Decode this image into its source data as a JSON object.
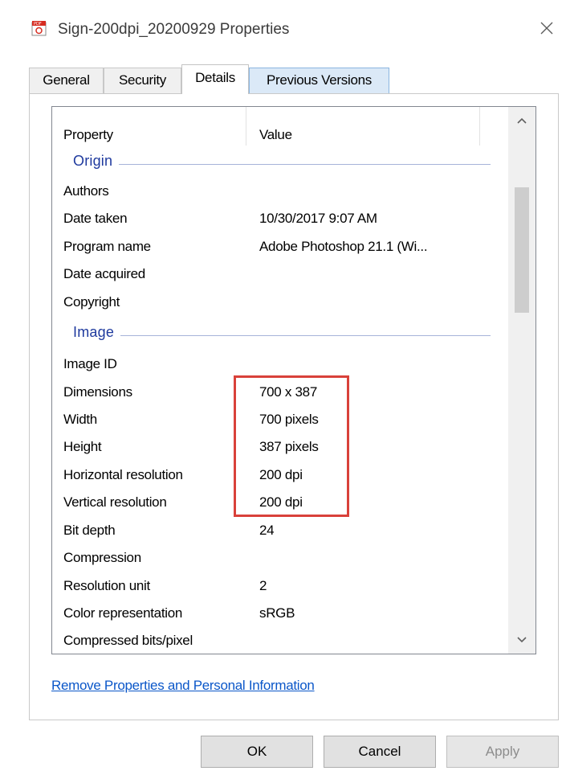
{
  "window": {
    "title": "Sign-200dpi_20200929 Properties",
    "title_icon": "pdf-file-icon",
    "close_icon": "close-icon"
  },
  "tabs": [
    {
      "label": "General"
    },
    {
      "label": "Security"
    },
    {
      "label": "Details",
      "active": true
    },
    {
      "label": "Previous Versions"
    }
  ],
  "details": {
    "header": {
      "property": "Property",
      "value": "Value"
    },
    "groups": [
      {
        "name": "Origin",
        "rows": [
          {
            "property": "Authors",
            "value": ""
          },
          {
            "property": "Date taken",
            "value": "10/30/2017 9:07 AM"
          },
          {
            "property": "Program name",
            "value": "Adobe Photoshop 21.1 (Wi..."
          },
          {
            "property": "Date acquired",
            "value": ""
          },
          {
            "property": "Copyright",
            "value": ""
          }
        ]
      },
      {
        "name": "Image",
        "rows": [
          {
            "property": "Image ID",
            "value": ""
          },
          {
            "property": "Dimensions",
            "value": "700 x 387"
          },
          {
            "property": "Width",
            "value": "700 pixels"
          },
          {
            "property": "Height",
            "value": "387 pixels"
          },
          {
            "property": "Horizontal resolution",
            "value": "200 dpi"
          },
          {
            "property": "Vertical resolution",
            "value": "200 dpi"
          },
          {
            "property": "Bit depth",
            "value": "24"
          },
          {
            "property": "Compression",
            "value": ""
          },
          {
            "property": "Resolution unit",
            "value": "2"
          },
          {
            "property": "Color representation",
            "value": "sRGB"
          },
          {
            "property": "Compressed bits/pixel",
            "value": ""
          }
        ]
      }
    ],
    "highlight_color": "#d9413a"
  },
  "link": {
    "label": "Remove Properties and Personal Information"
  },
  "buttons": {
    "ok": "OK",
    "cancel": "Cancel",
    "apply": "Apply"
  },
  "colors": {
    "group_label": "#1f3a9e",
    "link": "#0b57c9"
  }
}
